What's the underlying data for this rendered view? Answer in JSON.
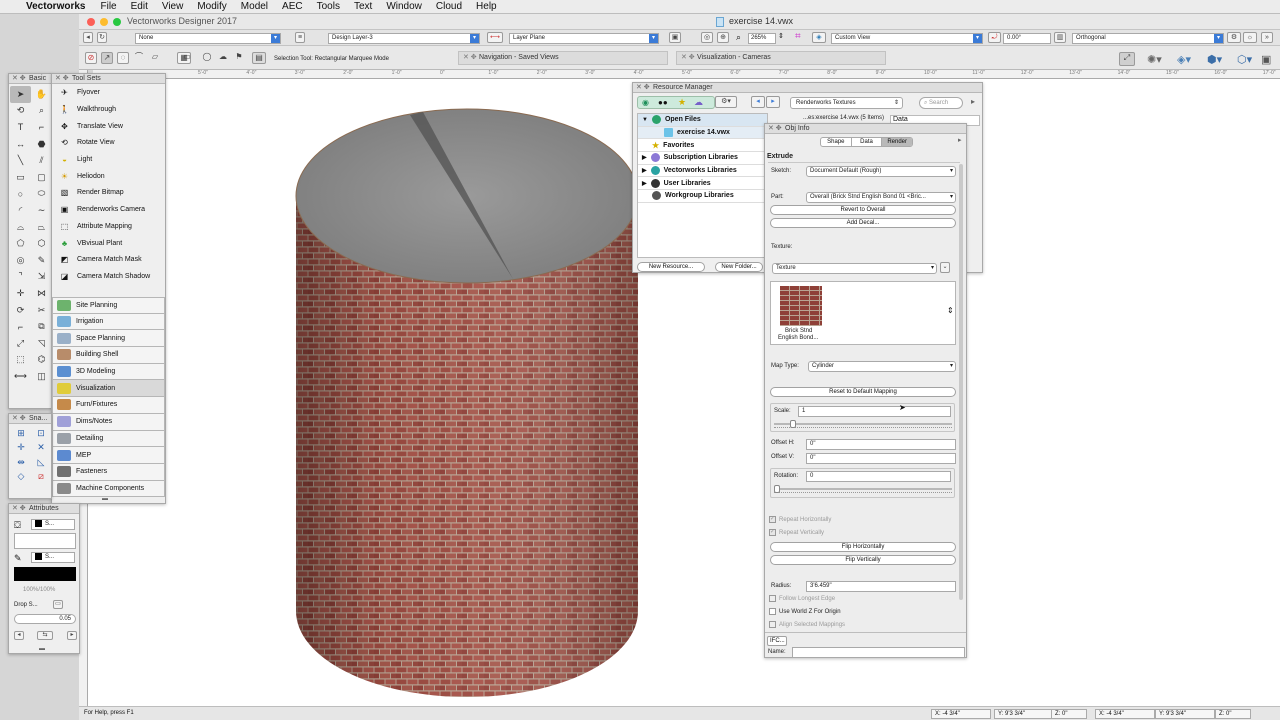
{
  "menubar": {
    "app_name": "Vectorworks",
    "items": [
      "File",
      "Edit",
      "View",
      "Modify",
      "Model",
      "AEC",
      "Tools",
      "Text",
      "Window",
      "Cloud",
      "Help"
    ]
  },
  "window": {
    "app_title": "Vectorworks Designer 2017",
    "doc_title": "exercise 14.vwx"
  },
  "viewbar": {
    "class_value": "None",
    "layer_value": "Design Layer-3",
    "plane_value": "Layer Plane",
    "zoom_value": "265%",
    "view_value": "Custom View",
    "rotation_value": "0.00°",
    "projection_value": "Orthogonal"
  },
  "modebar": {
    "tool_hint": "Selection Tool: Rectangular Marquee Mode"
  },
  "tabs": {
    "navigation": "Navigation - Saved Views",
    "visualization": "Visualization - Cameras"
  },
  "ruler_ticks": [
    "5'-0\"",
    "4'-0\"",
    "3'-0\"",
    "2'-0\"",
    "1'-0\"",
    "0\"",
    "1'-0\"",
    "2'-0\"",
    "3'-0\"",
    "4'-0\"",
    "5'-0\"",
    "6'-0\"",
    "7'-0\"",
    "8'-0\"",
    "9'-0\"",
    "10'-0\"",
    "11'-0\"",
    "12'-0\"",
    "13'-0\"",
    "14'-0\"",
    "15'-0\"",
    "16'-0\"",
    "17'-0\"",
    "18'-0\""
  ],
  "basic_palette": {
    "title": "Basic"
  },
  "tool_sets": {
    "title": "Tool Sets",
    "tools": [
      "Flyover",
      "Walkthrough",
      "Translate View",
      "Rotate View",
      "Light",
      "Heliodon",
      "Render Bitmap",
      "Renderworks Camera",
      "Attribute Mapping",
      "VBvisual Plant",
      "Camera Match Mask",
      "Camera Match Shadow"
    ],
    "sets": [
      "Site Planning",
      "Irrigation",
      "Space Planning",
      "Building Shell",
      "3D Modeling",
      "Visualization",
      "Furn/Fixtures",
      "Dims/Notes",
      "Detailing",
      "MEP",
      "Fasteners",
      "Machine Components"
    ]
  },
  "snapping": {
    "title": "Sna..."
  },
  "attributes": {
    "title": "Attributes",
    "pen_style": "S...",
    "fill_style": "S...",
    "opacity": "100%/100%",
    "drop_shadow": "Drop S...",
    "line_thickness": "0.05"
  },
  "resource_manager": {
    "title": "Resource Manager",
    "resource_type": "Renderworks Textures",
    "search_placeholder": "Search",
    "open_file_info": "...es:exercise 14.vwx  (5 Items)",
    "data_tab": "Data",
    "tree": [
      "Open Files",
      "exercise 14.vwx",
      "Favorites",
      "Subscription Libraries",
      "Vectorworks Libraries",
      "User Libraries",
      "Workgroup Libraries"
    ],
    "new_resource_btn": "New Resource...",
    "new_folder_btn": "New Folder..."
  },
  "obj_info": {
    "title": "Obj Info",
    "tabs": [
      "Shape",
      "Data",
      "Render"
    ],
    "active_tab": "Render",
    "object_type": "Extrude",
    "sketch_label": "Sketch:",
    "sketch_value": "Document Default (Rough)",
    "part_label": "Part:",
    "part_value": "Overall (Brick Stnd English Bond 01 <Bric...",
    "revert_btn": "Revert to Overall",
    "add_decal_btn": "Add Decal...",
    "texture_label": "Texture:",
    "texture_value": "Texture",
    "texture_name_line1": "Brick Stnd",
    "texture_name_line2": "English Bond...",
    "map_type_label": "Map Type:",
    "map_type_value": "Cylinder",
    "reset_mapping_btn": "Reset to Default Mapping",
    "scale_label": "Scale:",
    "scale_value": "1",
    "offset_h_label": "Offset H:",
    "offset_h_value": "0\"",
    "offset_v_label": "Offset V:",
    "offset_v_value": "0\"",
    "rotation_label": "Rotation:",
    "rotation_value": "0",
    "repeat_h": "Repeat Horizontally",
    "repeat_v": "Repeat Vertically",
    "flip_h_btn": "Flip Horizontally",
    "flip_v_btn": "Flip Vertically",
    "radius_label": "Radius:",
    "radius_value": "3'6.459\"",
    "follow_longest": "Follow Longest Edge",
    "use_world_z": "Use World Z For Origin",
    "align_mappings": "Align Selected Mappings",
    "ifc_btn": "IFC...",
    "name_label": "Name:"
  },
  "status": {
    "help": "For Help, press F1",
    "x": "X:  -4 3/4\"",
    "y": "Y:  9'3 3/4\"",
    "z": "Z:  0\"",
    "x2": "X:  -4 3/4\"",
    "y2": "Y:  9'3 3/4\"",
    "z2": "Z:  0\""
  },
  "colors": {
    "accent": "#3b7bd7",
    "brick": "#9c4a40",
    "mortar": "#b9a493",
    "cylinder_top": "#8a8a8a"
  }
}
